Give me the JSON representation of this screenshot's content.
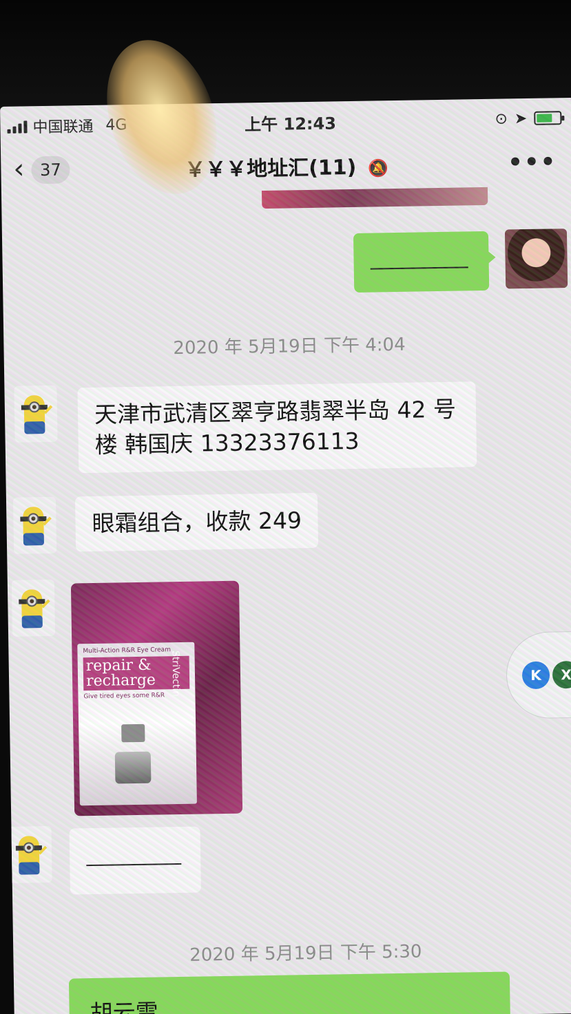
{
  "status_bar": {
    "carrier": "中国联通",
    "network": "4G",
    "time": "上午 12:43"
  },
  "nav": {
    "back_count": "37",
    "title": "￥￥￥地址汇(11)",
    "more": "•••"
  },
  "messages": [
    {
      "type": "text",
      "sender": "self",
      "text": "——————"
    },
    {
      "type": "timestamp",
      "text": "2020 年 5月19日 下午 4:04"
    },
    {
      "type": "text",
      "sender": "other",
      "text": "天津市武清区翠亨路翡翠半岛 42 号楼 韩国庆 13323376113"
    },
    {
      "type": "text",
      "sender": "other",
      "text": "眼霜组合，收款 249"
    },
    {
      "type": "image",
      "sender": "other",
      "product_text": {
        "top": "Multi-Action R&R Eye Cream",
        "main": "repair & recharge",
        "sub": "Give tired eyes some R&R",
        "brand": "StriVectin"
      }
    },
    {
      "type": "text",
      "sender": "other",
      "text": "————"
    },
    {
      "type": "timestamp",
      "text": "2020 年 5月19日 下午 5:30"
    },
    {
      "type": "text",
      "sender": "self",
      "text": "胡云雷"
    }
  ],
  "floating": {
    "k_label": "K",
    "x_label": "X"
  },
  "colors": {
    "green_bubble": "#86d85a",
    "white_bubble": "#f7f6f8",
    "background": "#e9e7ea"
  }
}
